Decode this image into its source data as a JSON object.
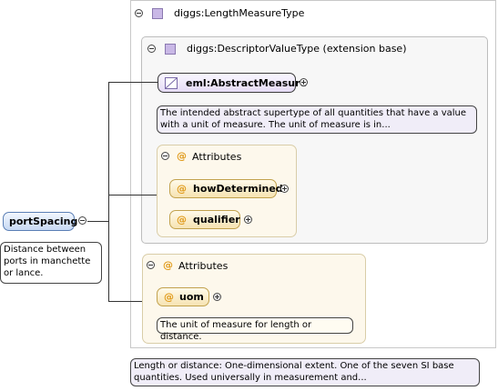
{
  "type_box": {
    "title": "diggs:LengthMeasureType"
  },
  "extension_box": {
    "title": "diggs:DescriptorValueType (extension base)"
  },
  "abstract_measure": {
    "label": "eml:AbstractMeasure",
    "doc_line1": "The intended abstract supertype of all quantities that have a value",
    "doc_line2": "with a unit of measure. The unit of measure is in..."
  },
  "inner_attributes": {
    "title": "Attributes",
    "items": [
      {
        "label": "howDetermined"
      },
      {
        "label": "qualifier"
      }
    ]
  },
  "outer_attributes": {
    "title": "Attributes",
    "items": [
      {
        "label": "uom",
        "doc": "The unit of measure for length or distance."
      }
    ]
  },
  "root": {
    "label": "portSpacing",
    "doc_line1": "Distance between",
    "doc_line2": "ports in manchette",
    "doc_line3": "or lance."
  },
  "type_doc": {
    "line1": "Length or distance: One-dimensional extent. One of the seven SI base",
    "line2": "quantities. Used universally in measurement and..."
  },
  "icons": [
    "collapse-icon",
    "expand-icon",
    "complex-type-icon",
    "abstract-element-icon",
    "attribute-icon"
  ],
  "colors": {
    "type_icon": "#c9b8e6",
    "attribute_at": "#e09a1a",
    "attribute_fill": "#f6e3b2",
    "root_fill": "#c7d9f3",
    "element_fill": "#e6dcf6"
  }
}
